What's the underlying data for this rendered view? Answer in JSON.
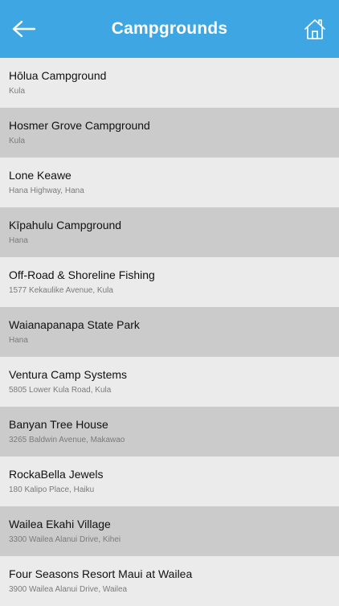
{
  "header": {
    "title": "Campgrounds",
    "back_icon": "back-arrow-icon",
    "home_icon": "home-icon",
    "color": "#3ea7e3"
  },
  "list": {
    "colors": {
      "light": "#ebebeb",
      "dark": "#cbcbcb"
    },
    "items": [
      {
        "title": "Hōlua Campground",
        "subtitle": "Kula"
      },
      {
        "title": "Hosmer Grove Campground",
        "subtitle": "Kula"
      },
      {
        "title": "Lone Keawe",
        "subtitle": "Hana Highway, Hana"
      },
      {
        "title": "Kīpahulu Campground",
        "subtitle": "Hana"
      },
      {
        "title": "Off-Road & Shoreline Fishing",
        "subtitle": "1577 Kekaulike Avenue, Kula"
      },
      {
        "title": "Waianapanapa State Park",
        "subtitle": "Hana"
      },
      {
        "title": "Ventura Camp Systems",
        "subtitle": "5805 Lower Kula Road, Kula"
      },
      {
        "title": "Banyan Tree House",
        "subtitle": "3265 Baldwin Avenue, Makawao"
      },
      {
        "title": "RockaBella Jewels",
        "subtitle": "180 Kalipo Place, Haiku"
      },
      {
        "title": "Wailea Ekahi Village",
        "subtitle": "3300 Wailea Alanui Drive, Kihei"
      },
      {
        "title": "Four Seasons Resort Maui at Wailea",
        "subtitle": "3900 Wailea Alanui Drive, Wailea"
      }
    ]
  }
}
